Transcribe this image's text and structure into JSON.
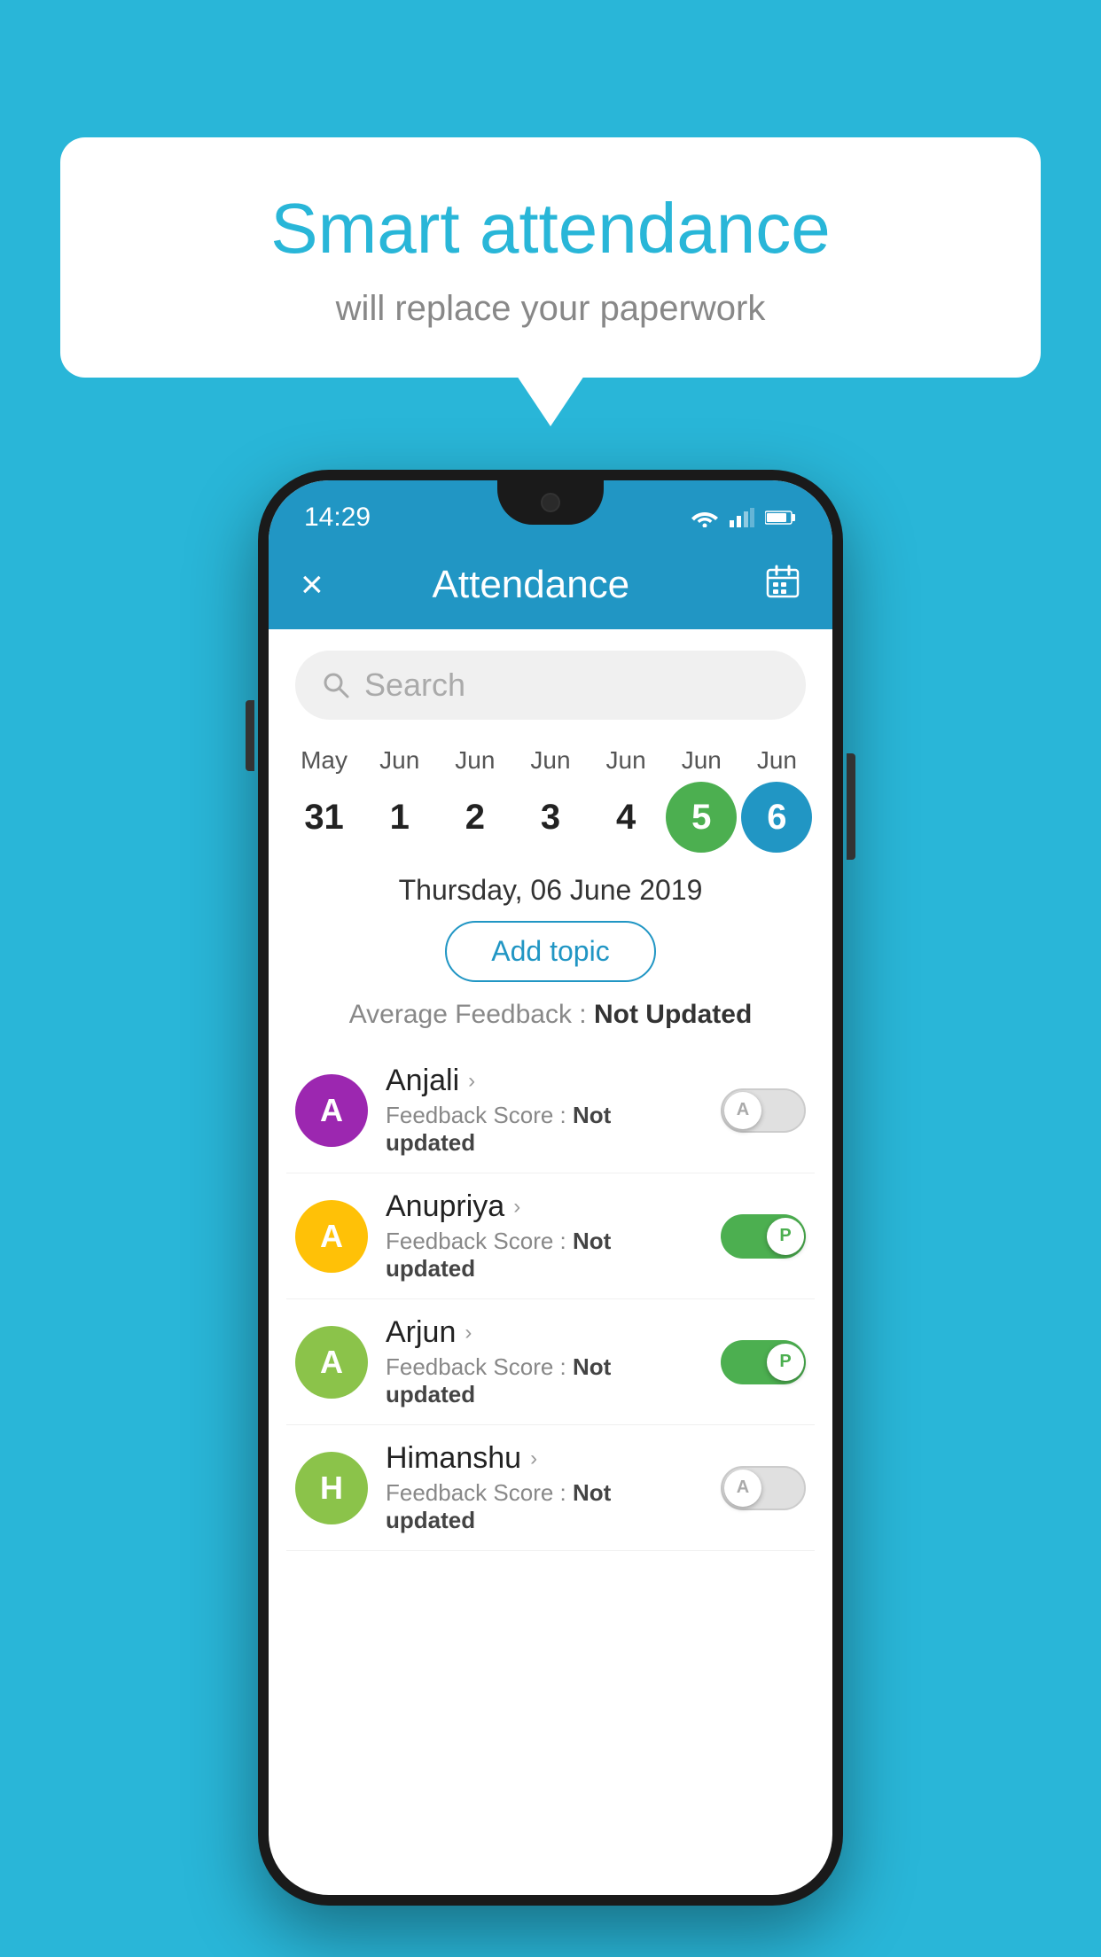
{
  "background": {
    "color": "#29b6d8"
  },
  "speech_bubble": {
    "title": "Smart attendance",
    "subtitle": "will replace your paperwork"
  },
  "phone": {
    "status_bar": {
      "time": "14:29"
    },
    "header": {
      "close_label": "×",
      "title": "Attendance",
      "calendar_icon": "📅"
    },
    "search": {
      "placeholder": "Search"
    },
    "calendar": {
      "months": [
        "May",
        "Jun",
        "Jun",
        "Jun",
        "Jun",
        "Jun",
        "Jun"
      ],
      "dates": [
        "31",
        "1",
        "2",
        "3",
        "4",
        "5",
        "6"
      ],
      "selected_green_index": 5,
      "selected_blue_index": 6
    },
    "selected_date": "Thursday, 06 June 2019",
    "add_topic_label": "Add topic",
    "avg_feedback": {
      "label": "Average Feedback :",
      "value": "Not Updated"
    },
    "students": [
      {
        "name": "Anjali",
        "avatar_letter": "A",
        "avatar_color": "#9c27b0",
        "feedback_label": "Feedback Score :",
        "feedback_value": "Not updated",
        "toggle_state": "off",
        "toggle_label": "A"
      },
      {
        "name": "Anupriya",
        "avatar_letter": "A",
        "avatar_color": "#ffc107",
        "feedback_label": "Feedback Score :",
        "feedback_value": "Not updated",
        "toggle_state": "on",
        "toggle_label": "P"
      },
      {
        "name": "Arjun",
        "avatar_letter": "A",
        "avatar_color": "#8bc34a",
        "feedback_label": "Feedback Score :",
        "feedback_value": "Not updated",
        "toggle_state": "on",
        "toggle_label": "P"
      },
      {
        "name": "Himanshu",
        "avatar_letter": "H",
        "avatar_color": "#8bc34a",
        "feedback_label": "Feedback Score :",
        "feedback_value": "Not updated",
        "toggle_state": "off",
        "toggle_label": "A"
      }
    ]
  }
}
